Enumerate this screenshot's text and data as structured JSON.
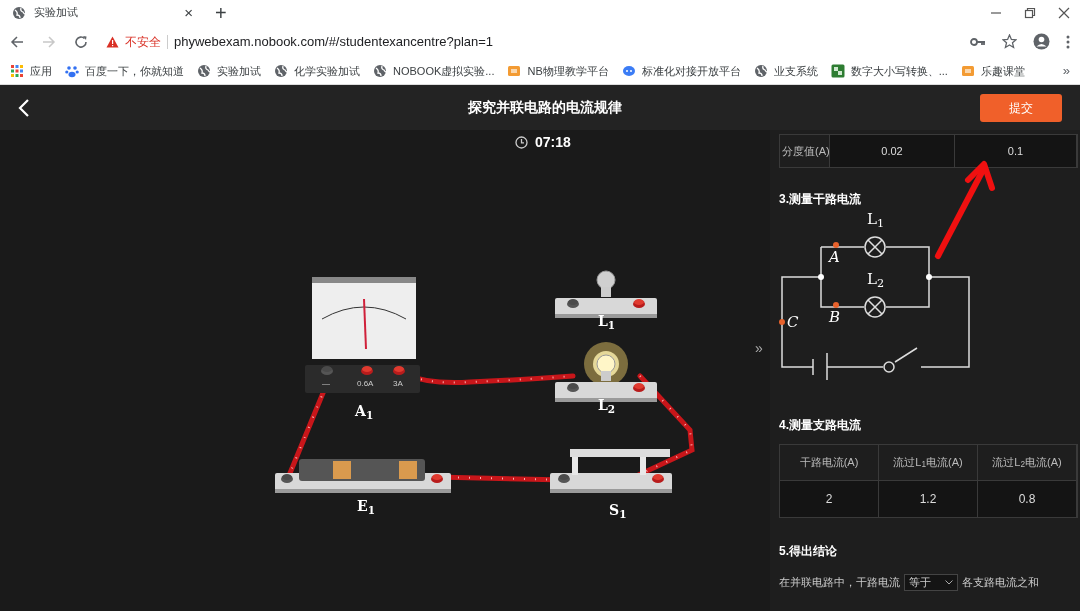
{
  "browser": {
    "tab": {
      "title": "实验加试",
      "close": "×",
      "new_tab": "+"
    },
    "address": {
      "warning": "不安全",
      "url": "phywebexam.nobook.com/#/studentexancentre?plan=1"
    },
    "bookmarks": [
      {
        "label": "应用"
      },
      {
        "label": "百度一下，你就知道"
      },
      {
        "label": "实验加试"
      },
      {
        "label": "化学实验加试"
      },
      {
        "label": "NOBOOK虚拟实验..."
      },
      {
        "label": "NB物理教学平台"
      },
      {
        "label": "标准化对接开放平台"
      },
      {
        "label": "业支系统"
      },
      {
        "label": "数字大小写转换、..."
      },
      {
        "label": "乐趣课堂"
      }
    ],
    "bookmarks_overflow": "»"
  },
  "header": {
    "title": "探究并联电路的电流规律",
    "submit": "提交",
    "timer": "07:18"
  },
  "circuit": {
    "components": [
      {
        "kind": "ammeter",
        "label": "A$_{1}$",
        "terminals": [
          "—",
          "0.6A",
          "3A"
        ]
      },
      {
        "kind": "bulb",
        "label": "L$_{1}$",
        "lit": false
      },
      {
        "kind": "bulb",
        "label": "L$_{2}$",
        "lit": true
      },
      {
        "kind": "battery",
        "label": "E$_{1}$"
      },
      {
        "kind": "switch",
        "label": "S$_{1}$"
      }
    ]
  },
  "panel_toggle": "»",
  "panel": {
    "scale_row": {
      "label": "分度值(A)",
      "values": [
        "0.02",
        "0.1"
      ]
    },
    "section3": {
      "title": "3.测量干路电流",
      "diagram": {
        "lamps": [
          "L$_{1}$",
          "L$_{2}$"
        ],
        "points": [
          "A",
          "B",
          "C"
        ]
      }
    },
    "section4": {
      "title": "4.测量支路电流",
      "columns": [
        "干路电流(A)",
        "流过L$_{1}$电流(A)",
        "流过L$_{2}$电流(A)"
      ],
      "row": [
        "2",
        "1.2",
        "0.8"
      ]
    },
    "section5": {
      "title": "5.得出结论",
      "before": "在并联电路中，干路电流",
      "select": "等于",
      "after": "各支路电流之和"
    }
  }
}
